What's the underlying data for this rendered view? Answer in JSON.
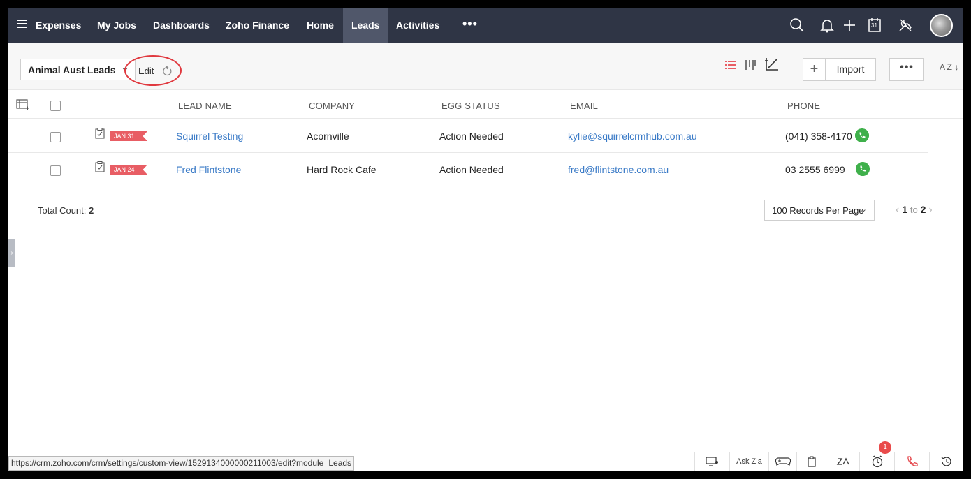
{
  "nav": {
    "items": [
      "Expenses",
      "My Jobs",
      "Dashboards",
      "Zoho Finance",
      "Home",
      "Leads",
      "Activities"
    ],
    "active": "Leads",
    "more": "•••",
    "calendar_day": "31"
  },
  "toolbar": {
    "view_name": "Animal Aust Leads",
    "edit_label": "Edit",
    "import_label": "Import",
    "more_label": "•••",
    "sort_label": "A Z"
  },
  "table": {
    "headers": [
      "LEAD NAME",
      "COMPANY",
      "EGG STATUS",
      "EMAIL",
      "PHONE"
    ],
    "rows": [
      {
        "date": "JAN 31",
        "lead_name": "Squirrel Testing",
        "company": "Acornville",
        "egg_status": "Action Needed",
        "email": "kylie@squirrelcrmhub.com.au",
        "phone": "(041) 358-4170"
      },
      {
        "date": "JAN 24",
        "lead_name": "Fred Flintstone",
        "company": "Hard Rock Cafe",
        "egg_status": "Action Needed",
        "email": "fred@flintstone.com.au",
        "phone": "03 2555 6999"
      }
    ]
  },
  "footer": {
    "total_label": "Total Count:",
    "total_value": "2",
    "per_page": "100 Records Per Page",
    "page_from": "1",
    "page_to_label": "to",
    "page_to": "2"
  },
  "bottombar": {
    "ask_zia": "Ask Zia",
    "notification_count": "1"
  },
  "status_url": "https://crm.zoho.com/crm/settings/custom-view/1529134000000211003/edit?module=Leads",
  "colors": {
    "nav_bg": "#2f3545",
    "active_tab": "#50576a",
    "link": "#3b7bc7",
    "flag": "#e85d64",
    "phone": "#3fb04b",
    "highlight": "#e0393f"
  }
}
